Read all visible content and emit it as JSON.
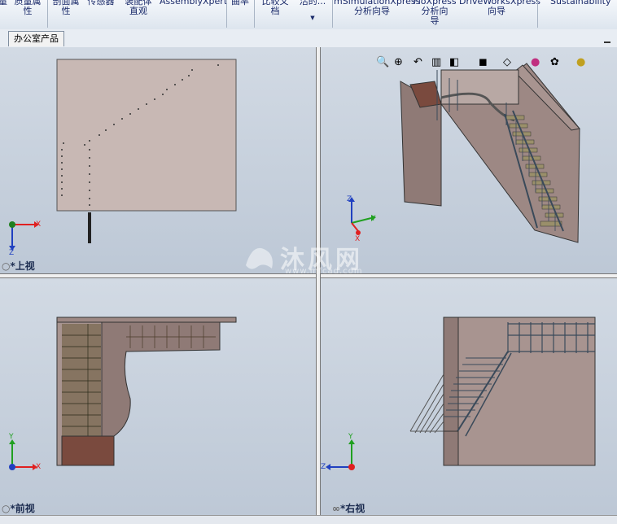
{
  "ribbon": {
    "items": [
      {
        "label": "质量属\n性"
      },
      {
        "label": "剖面属\n性"
      },
      {
        "label": "传感器"
      },
      {
        "label": "装配体\n直观"
      },
      {
        "label": "AssemblyXpert"
      },
      {
        "label": "曲率"
      },
      {
        "label": "比较文\n档"
      },
      {
        "label": "活的..."
      },
      {
        "label": "mSimulationXpress\n分析向导"
      },
      {
        "label": "FloXpress\n分析向\n导"
      },
      {
        "label": "DriveWorksXpress\n向导"
      },
      {
        "label": "Sustainability"
      }
    ]
  },
  "document_tab": {
    "label": "办公室产品"
  },
  "views": {
    "top": {
      "label": "*上视"
    },
    "front": {
      "label": "*前视"
    },
    "right": {
      "label": "*右视"
    }
  },
  "axes": {
    "x": "X",
    "y": "Y",
    "z": "Z"
  },
  "watermark": {
    "brand": "沐风网",
    "url": "www.mfcad.com"
  },
  "colors": {
    "wall": "#8f7a76",
    "wall_light": "#c8b8b4",
    "landing": "#7a4a3e",
    "tread": "#9a8f6a",
    "rail": "#3a4a5a",
    "axis_x": "#e02020",
    "axis_y": "#20a020",
    "axis_z": "#2040c0"
  }
}
